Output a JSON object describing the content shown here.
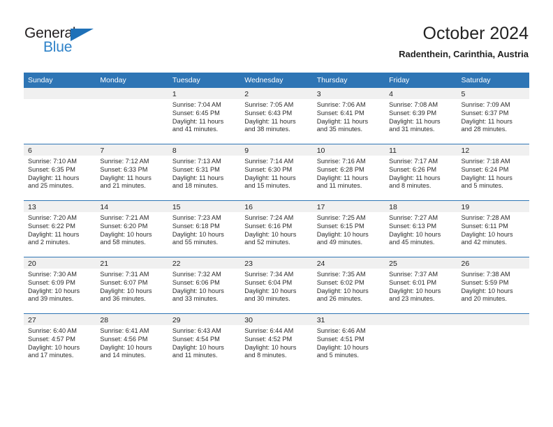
{
  "brand": {
    "name_part1": "General",
    "name_part2": "Blue",
    "logo_icon": "triangle-logo-icon"
  },
  "header": {
    "title": "October 2024",
    "subtitle": "Radenthein, Carinthia, Austria"
  },
  "colors": {
    "header_blue": "#2E75B5",
    "brand_blue": "#2E82C8",
    "band_gray": "#F0F0F0"
  },
  "calendar": {
    "weekday_headers": [
      "Sunday",
      "Monday",
      "Tuesday",
      "Wednesday",
      "Thursday",
      "Friday",
      "Saturday"
    ],
    "weeks": [
      [
        {
          "day": "",
          "lines": []
        },
        {
          "day": "",
          "lines": []
        },
        {
          "day": "1",
          "lines": [
            "Sunrise: 7:04 AM",
            "Sunset: 6:45 PM",
            "Daylight: 11 hours",
            "and 41 minutes."
          ]
        },
        {
          "day": "2",
          "lines": [
            "Sunrise: 7:05 AM",
            "Sunset: 6:43 PM",
            "Daylight: 11 hours",
            "and 38 minutes."
          ]
        },
        {
          "day": "3",
          "lines": [
            "Sunrise: 7:06 AM",
            "Sunset: 6:41 PM",
            "Daylight: 11 hours",
            "and 35 minutes."
          ]
        },
        {
          "day": "4",
          "lines": [
            "Sunrise: 7:08 AM",
            "Sunset: 6:39 PM",
            "Daylight: 11 hours",
            "and 31 minutes."
          ]
        },
        {
          "day": "5",
          "lines": [
            "Sunrise: 7:09 AM",
            "Sunset: 6:37 PM",
            "Daylight: 11 hours",
            "and 28 minutes."
          ]
        }
      ],
      [
        {
          "day": "6",
          "lines": [
            "Sunrise: 7:10 AM",
            "Sunset: 6:35 PM",
            "Daylight: 11 hours",
            "and 25 minutes."
          ]
        },
        {
          "day": "7",
          "lines": [
            "Sunrise: 7:12 AM",
            "Sunset: 6:33 PM",
            "Daylight: 11 hours",
            "and 21 minutes."
          ]
        },
        {
          "day": "8",
          "lines": [
            "Sunrise: 7:13 AM",
            "Sunset: 6:31 PM",
            "Daylight: 11 hours",
            "and 18 minutes."
          ]
        },
        {
          "day": "9",
          "lines": [
            "Sunrise: 7:14 AM",
            "Sunset: 6:30 PM",
            "Daylight: 11 hours",
            "and 15 minutes."
          ]
        },
        {
          "day": "10",
          "lines": [
            "Sunrise: 7:16 AM",
            "Sunset: 6:28 PM",
            "Daylight: 11 hours",
            "and 11 minutes."
          ]
        },
        {
          "day": "11",
          "lines": [
            "Sunrise: 7:17 AM",
            "Sunset: 6:26 PM",
            "Daylight: 11 hours",
            "and 8 minutes."
          ]
        },
        {
          "day": "12",
          "lines": [
            "Sunrise: 7:18 AM",
            "Sunset: 6:24 PM",
            "Daylight: 11 hours",
            "and 5 minutes."
          ]
        }
      ],
      [
        {
          "day": "13",
          "lines": [
            "Sunrise: 7:20 AM",
            "Sunset: 6:22 PM",
            "Daylight: 11 hours",
            "and 2 minutes."
          ]
        },
        {
          "day": "14",
          "lines": [
            "Sunrise: 7:21 AM",
            "Sunset: 6:20 PM",
            "Daylight: 10 hours",
            "and 58 minutes."
          ]
        },
        {
          "day": "15",
          "lines": [
            "Sunrise: 7:23 AM",
            "Sunset: 6:18 PM",
            "Daylight: 10 hours",
            "and 55 minutes."
          ]
        },
        {
          "day": "16",
          "lines": [
            "Sunrise: 7:24 AM",
            "Sunset: 6:16 PM",
            "Daylight: 10 hours",
            "and 52 minutes."
          ]
        },
        {
          "day": "17",
          "lines": [
            "Sunrise: 7:25 AM",
            "Sunset: 6:15 PM",
            "Daylight: 10 hours",
            "and 49 minutes."
          ]
        },
        {
          "day": "18",
          "lines": [
            "Sunrise: 7:27 AM",
            "Sunset: 6:13 PM",
            "Daylight: 10 hours",
            "and 45 minutes."
          ]
        },
        {
          "day": "19",
          "lines": [
            "Sunrise: 7:28 AM",
            "Sunset: 6:11 PM",
            "Daylight: 10 hours",
            "and 42 minutes."
          ]
        }
      ],
      [
        {
          "day": "20",
          "lines": [
            "Sunrise: 7:30 AM",
            "Sunset: 6:09 PM",
            "Daylight: 10 hours",
            "and 39 minutes."
          ]
        },
        {
          "day": "21",
          "lines": [
            "Sunrise: 7:31 AM",
            "Sunset: 6:07 PM",
            "Daylight: 10 hours",
            "and 36 minutes."
          ]
        },
        {
          "day": "22",
          "lines": [
            "Sunrise: 7:32 AM",
            "Sunset: 6:06 PM",
            "Daylight: 10 hours",
            "and 33 minutes."
          ]
        },
        {
          "day": "23",
          "lines": [
            "Sunrise: 7:34 AM",
            "Sunset: 6:04 PM",
            "Daylight: 10 hours",
            "and 30 minutes."
          ]
        },
        {
          "day": "24",
          "lines": [
            "Sunrise: 7:35 AM",
            "Sunset: 6:02 PM",
            "Daylight: 10 hours",
            "and 26 minutes."
          ]
        },
        {
          "day": "25",
          "lines": [
            "Sunrise: 7:37 AM",
            "Sunset: 6:01 PM",
            "Daylight: 10 hours",
            "and 23 minutes."
          ]
        },
        {
          "day": "26",
          "lines": [
            "Sunrise: 7:38 AM",
            "Sunset: 5:59 PM",
            "Daylight: 10 hours",
            "and 20 minutes."
          ]
        }
      ],
      [
        {
          "day": "27",
          "lines": [
            "Sunrise: 6:40 AM",
            "Sunset: 4:57 PM",
            "Daylight: 10 hours",
            "and 17 minutes."
          ]
        },
        {
          "day": "28",
          "lines": [
            "Sunrise: 6:41 AM",
            "Sunset: 4:56 PM",
            "Daylight: 10 hours",
            "and 14 minutes."
          ]
        },
        {
          "day": "29",
          "lines": [
            "Sunrise: 6:43 AM",
            "Sunset: 4:54 PM",
            "Daylight: 10 hours",
            "and 11 minutes."
          ]
        },
        {
          "day": "30",
          "lines": [
            "Sunrise: 6:44 AM",
            "Sunset: 4:52 PM",
            "Daylight: 10 hours",
            "and 8 minutes."
          ]
        },
        {
          "day": "31",
          "lines": [
            "Sunrise: 6:46 AM",
            "Sunset: 4:51 PM",
            "Daylight: 10 hours",
            "and 5 minutes."
          ]
        },
        {
          "day": "",
          "lines": []
        },
        {
          "day": "",
          "lines": []
        }
      ]
    ]
  }
}
